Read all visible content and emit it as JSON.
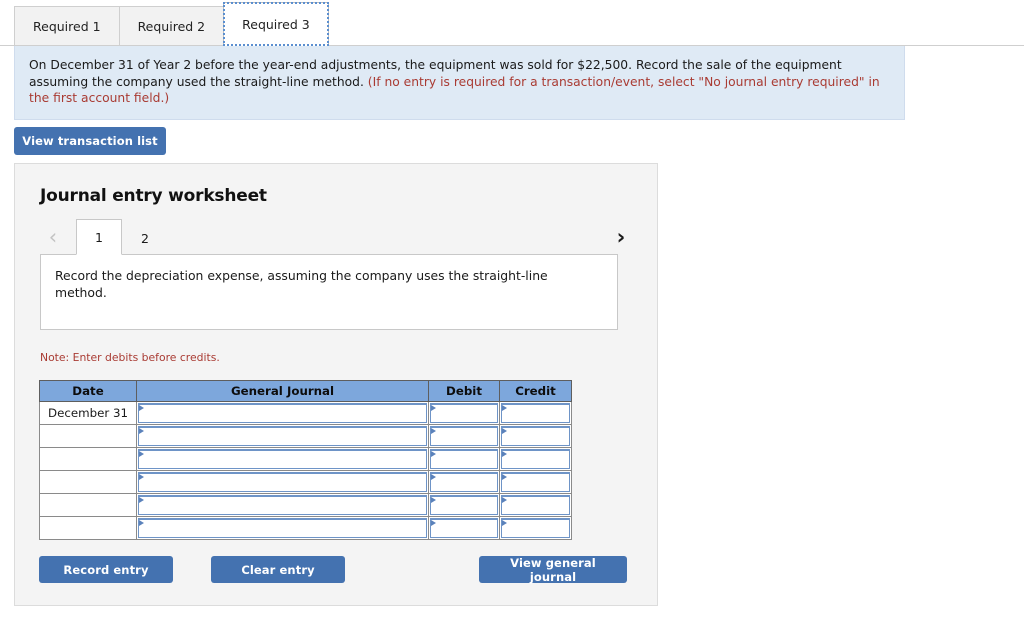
{
  "required_tabs": [
    {
      "label": "Required 1",
      "active": false
    },
    {
      "label": "Required 2",
      "active": false
    },
    {
      "label": "Required 3",
      "active": true
    }
  ],
  "banner": {
    "text_main": "On December 31 of Year 2 before the year-end adjustments, the equipment was sold for $22,500. Record the sale of the equipment assuming the company used the straight-line method. ",
    "text_hint": "(If no entry is required for a transaction/event, select \"No journal entry required\" in the first account field.)"
  },
  "toolbar": {
    "view_transaction_list_label": "View transaction list"
  },
  "worksheet": {
    "title": "Journal entry worksheet",
    "prev_icon": "chevron-left-icon",
    "next_icon": "chevron-right-icon",
    "pages": [
      {
        "label": "1",
        "active": true
      },
      {
        "label": "2",
        "active": false
      }
    ],
    "description": "Record the depreciation expense, assuming the company uses the straight-line method.",
    "note": "Note: Enter debits before credits."
  },
  "journal_table": {
    "headers": [
      "Date",
      "General Journal",
      "Debit",
      "Credit"
    ],
    "rows": [
      {
        "date": "December 31",
        "general_journal": "",
        "debit": "",
        "credit": ""
      },
      {
        "date": "",
        "general_journal": "",
        "debit": "",
        "credit": ""
      },
      {
        "date": "",
        "general_journal": "",
        "debit": "",
        "credit": ""
      },
      {
        "date": "",
        "general_journal": "",
        "debit": "",
        "credit": ""
      },
      {
        "date": "",
        "general_journal": "",
        "debit": "",
        "credit": ""
      },
      {
        "date": "",
        "general_journal": "",
        "debit": "",
        "credit": ""
      }
    ]
  },
  "footer": {
    "record_entry_label": "Record entry",
    "clear_entry_label": "Clear entry",
    "view_general_journal_label": "View general journal"
  },
  "colors": {
    "accent_blue": "#4472b0",
    "table_header_blue": "#7da7dc",
    "banner_blue": "#dfeaf5",
    "hint_red": "#a93b33",
    "panel_gray": "#f4f4f4"
  }
}
